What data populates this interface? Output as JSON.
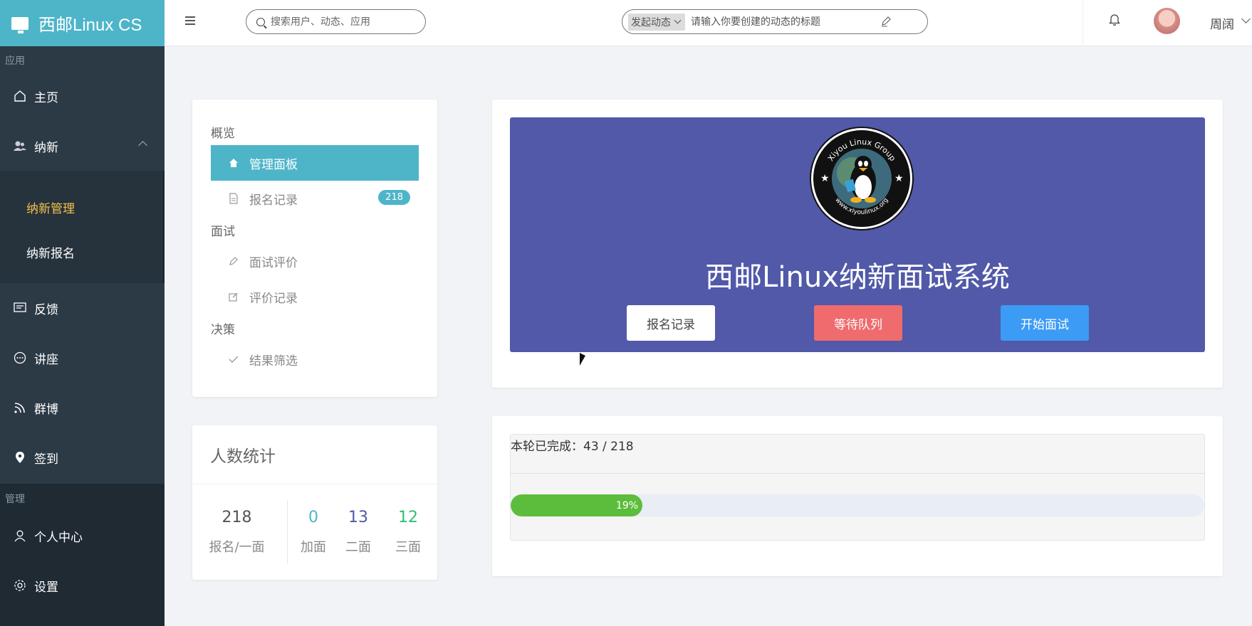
{
  "app": {
    "title": "西邮Linux CS"
  },
  "sidebar": {
    "section_apps": "应用",
    "section_manage": "管理",
    "items": [
      {
        "label": "主页",
        "icon": "home-icon"
      },
      {
        "label": "纳新",
        "icon": "users-icon"
      },
      {
        "label": "反馈",
        "icon": "message-icon"
      },
      {
        "label": "讲座",
        "icon": "chat-icon"
      },
      {
        "label": "群博",
        "icon": "rss-icon"
      },
      {
        "label": "签到",
        "icon": "location-icon"
      }
    ],
    "sub_items": [
      {
        "label": "纳新管理",
        "active": true
      },
      {
        "label": "纳新报名",
        "active": false
      }
    ],
    "manage_items": [
      {
        "label": "个人中心",
        "icon": "user-icon"
      },
      {
        "label": "设置",
        "icon": "gear-icon"
      }
    ]
  },
  "topbar": {
    "search_placeholder": "搜索用户、动态、应用",
    "post_type": "发起动态",
    "post_placeholder": "请输入你要创建的动态的标题",
    "username": "周阔"
  },
  "overview": {
    "group1": "概览",
    "items1": [
      {
        "label": "管理面板",
        "active": true
      },
      {
        "label": "报名记录",
        "badge": "218"
      }
    ],
    "group2": "面试",
    "items2": [
      {
        "label": "面试评价"
      },
      {
        "label": "评价记录"
      }
    ],
    "group3": "决策",
    "items3": [
      {
        "label": "结果筛选"
      }
    ]
  },
  "stats": {
    "title": "人数统计",
    "items": [
      {
        "num": "218",
        "label": "报名/一面",
        "color": "#555555"
      },
      {
        "num": "0",
        "label": "加面",
        "color": "#4eb5c9"
      },
      {
        "num": "13",
        "label": "二面",
        "color": "#5159a8"
      },
      {
        "num": "12",
        "label": "三面",
        "color": "#2fbf71"
      }
    ]
  },
  "hero": {
    "title": "西邮Linux纳新面试系统",
    "logo_text": "Xiyou Linux Group",
    "logo_url": "www.xiyoulinux.org",
    "btn_records": "报名记录",
    "btn_queue": "等待队列",
    "btn_start": "开始面试",
    "bg_color": "#5159a8"
  },
  "progress": {
    "label": "本轮已完成：43 / 218",
    "percent_text": "19%",
    "value": 0.19
  }
}
